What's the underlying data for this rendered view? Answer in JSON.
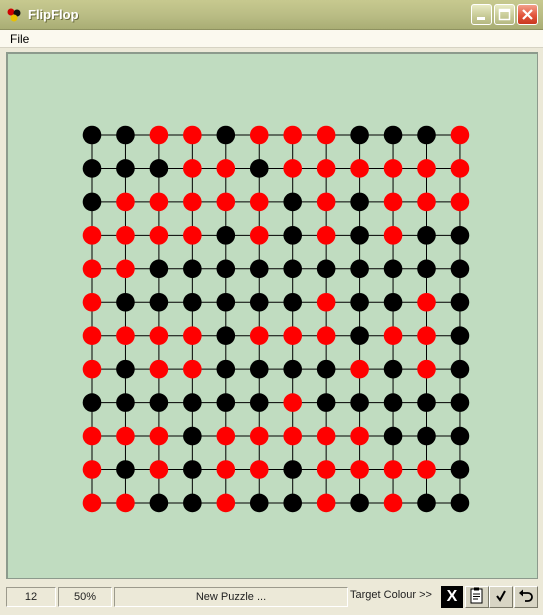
{
  "window": {
    "title": "FlipFlop",
    "app_icon": "flipflop-app-icon"
  },
  "menu": {
    "items": [
      "File"
    ]
  },
  "board": {
    "size": 12,
    "colors": {
      "background": "#c0dcc0",
      "red": "#ff0000",
      "black": "#000000",
      "line": "#000000"
    },
    "rows": [
      "BBRRBRRRBBBR",
      "BBBRRBRRRRRR",
      "BRRRRRBRBRRR",
      "RRRRBRBRBRBB",
      "RRBBBBBBBBBB",
      "RBBBBBBRBBRB",
      "RRRRBRRRBRRB",
      "RBRRBBBBRBRB",
      "BBBBBBRBBBBB",
      "RRRBRRRRRBBB",
      "RBRBRRBRRRRB",
      "RRBBRBBRBRBB"
    ]
  },
  "status": {
    "size_value": "12",
    "percent_value": "50%",
    "message": "New Puzzle ...",
    "target_label": "Target Colour >>",
    "target_value": "X",
    "target_color": "#000000"
  }
}
